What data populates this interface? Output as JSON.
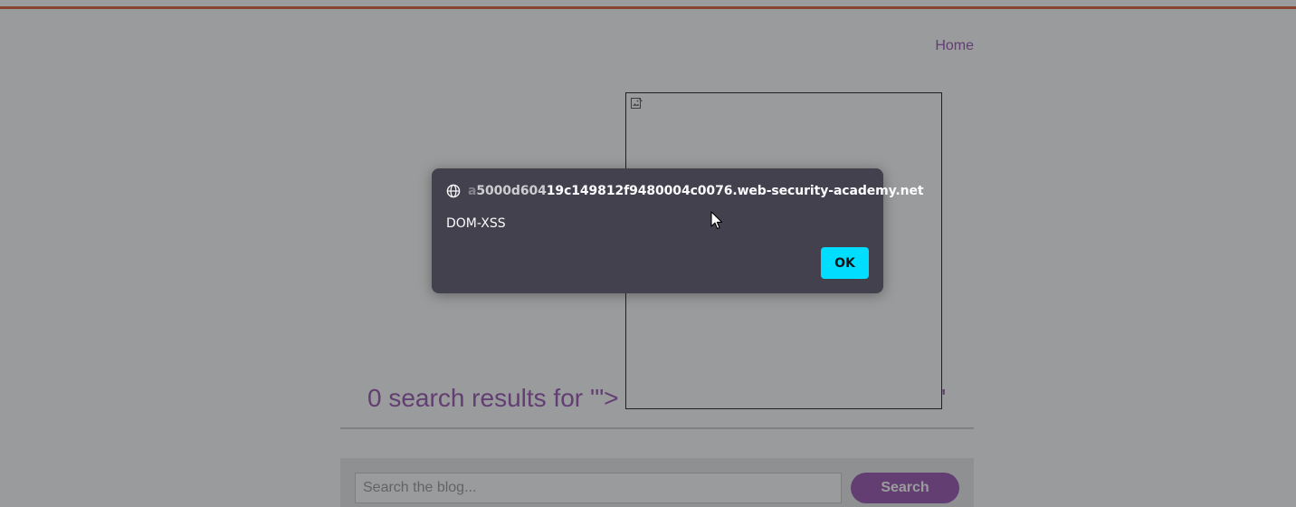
{
  "page": {
    "nav": {
      "home_label": "Home"
    },
    "results": {
      "heading": "0 search results for '\">",
      "tail": "'"
    },
    "search": {
      "placeholder": "Search the blog...",
      "button_label": "Search"
    }
  },
  "dialog": {
    "origin_faded": "a",
    "origin_mid": "5000d604",
    "origin_main": "19c149812f9480004c0076.web-security-academy.net",
    "message": "DOM-XSS",
    "ok_label": "OK"
  },
  "colors": {
    "brand_purple": "#9a56b5",
    "accent_orange": "#e0613a",
    "dialog_bg": "#42414d",
    "ok_button": "#00ddff"
  },
  "icons": [
    "globe-icon",
    "broken-image-icon",
    "cursor-icon"
  ]
}
